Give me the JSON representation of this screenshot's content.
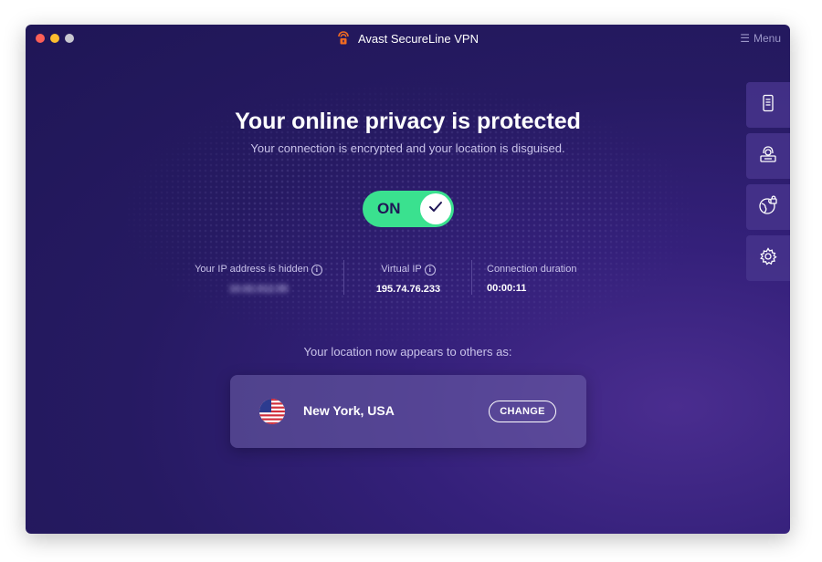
{
  "window": {
    "title": "Avast SecureLine VPN",
    "menu_label": "Menu"
  },
  "status": {
    "headline": "Your online privacy is protected",
    "subline": "Your connection is encrypted and your location is disguised.",
    "toggle_label": "ON",
    "toggle_color": "#3ae18f"
  },
  "stats": {
    "ip_hidden_label": "Your IP address is hidden",
    "ip_hidden_value": "10.02.012.55",
    "virtual_ip_label": "Virtual IP",
    "virtual_ip_value": "195.74.76.233",
    "duration_label": "Connection duration",
    "duration_value": "00:00:11"
  },
  "location": {
    "caption": "Your location now appears to others as:",
    "name": "New York, USA",
    "change_label": "CHANGE"
  },
  "side_rail": {
    "icons": [
      "device-icon",
      "hacker-icon",
      "globe-lock-icon",
      "gear-icon"
    ]
  },
  "colors": {
    "background": "#261a62",
    "accent_green": "#3ae18f",
    "logo_orange": "#f26b21"
  }
}
